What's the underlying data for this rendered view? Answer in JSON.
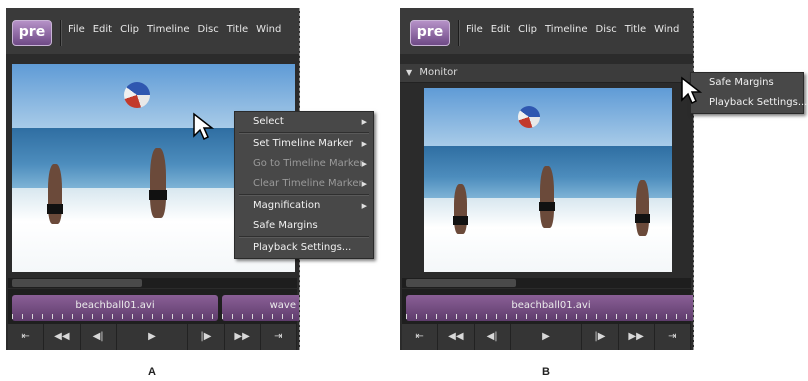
{
  "app": {
    "logo": "pre"
  },
  "menubar": {
    "items": [
      "File",
      "Edit",
      "Clip",
      "Timeline",
      "Disc",
      "Title",
      "Wind"
    ]
  },
  "panel_a": {
    "caption": "A",
    "context_menu": {
      "items": [
        {
          "label": "Select",
          "submenu": true,
          "enabled": true
        },
        {
          "label": "Set Timeline Marker",
          "submenu": true,
          "enabled": true
        },
        {
          "label": "Go to Timeline Marker",
          "submenu": true,
          "enabled": false
        },
        {
          "label": "Clear Timeline Marker",
          "submenu": true,
          "enabled": false
        },
        {
          "label": "Magnification",
          "submenu": true,
          "enabled": true
        },
        {
          "label": "Safe Margins",
          "submenu": false,
          "enabled": true
        },
        {
          "label": "Playback Settings...",
          "submenu": false,
          "enabled": true
        }
      ]
    },
    "clips": [
      "beachball01.avi",
      "wave"
    ]
  },
  "panel_b": {
    "caption": "B",
    "monitor_title": "Monitor",
    "context_menu": {
      "items": [
        "Safe Margins",
        "Playback Settings..."
      ]
    },
    "clips": [
      "beachball01.avi"
    ]
  },
  "transport": {
    "buttons": [
      "⇤",
      "◀◀",
      "◀|",
      "▶",
      "|▶",
      "▶▶",
      "⇥"
    ]
  },
  "colors": {
    "clip": "#7a5088",
    "panel": "#2b2b2b",
    "menu": "#484848"
  }
}
